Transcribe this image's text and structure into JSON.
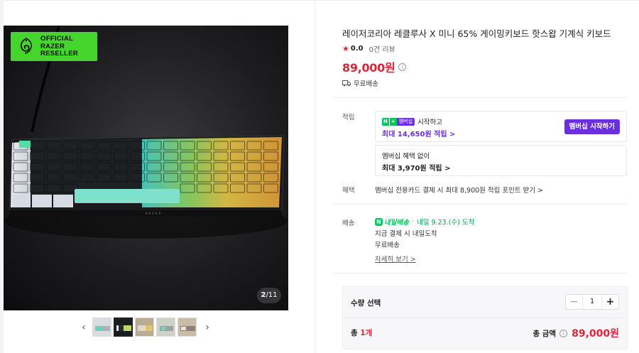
{
  "gallery": {
    "badge_text": "OFFICIAL\nRAZER\nRESELLER",
    "counter_current": "2",
    "counter_total": "/11",
    "prev_icon": "chevron-left-icon",
    "next_icon": "chevron-right-icon",
    "thumbnails": [
      "thumb-1",
      "thumb-2",
      "thumb-3",
      "thumb-4",
      "thumb-5"
    ],
    "active_thumbnail": 2
  },
  "product": {
    "title": "레이저코리아 레클루사 X 미니 65% 게이밍키보드 핫스왑 기계식 키보드",
    "rating": "0.0",
    "review_count": "0건 리뷰",
    "price": "89,000원",
    "shipping": "무료배송"
  },
  "points": {
    "label": "적립",
    "membership_start_text": "시작하고",
    "membership_badge_n": "N",
    "membership_badge_plus": "+",
    "membership_badge_label": "멤버십",
    "membership_max": "최대 14,650원 적립 >",
    "membership_button": "멤버십 시작하기",
    "no_membership_title": "멤버십 혜택 없이",
    "no_membership_max": "최대 3,970원 적립 >"
  },
  "benefit": {
    "label": "혜택",
    "text": "멤버십 전용카드 결제 시 최대 8,900원 적립 포인트 받기 >"
  },
  "delivery": {
    "label": "배송",
    "brand": "내일배송",
    "brand_icon_text": "N",
    "date": "내일 9.23.(수) 도착",
    "line2": "지금 결제 시 내일도착",
    "line3": "무료배송",
    "detail_link": "자세히 보기 >"
  },
  "quantity": {
    "label": "수량 선택",
    "minus": "−",
    "value": "1",
    "plus": "+",
    "total_count_prefix": "총 ",
    "total_count_num": "1개",
    "total_label": "총 금액",
    "total_price": "89,000원"
  },
  "colors": {
    "price_red": "#d8273b",
    "membership_purple": "#6b2fe0",
    "naver_green": "#03c75a",
    "razer_green": "#44d62c"
  }
}
